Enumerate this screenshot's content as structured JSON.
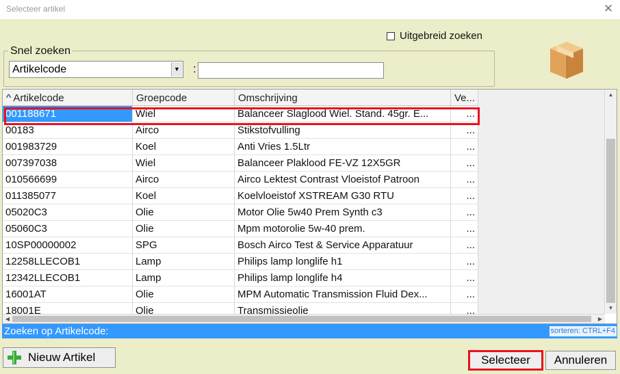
{
  "window": {
    "title": "Selecteer artikel",
    "close_glyph": "✕"
  },
  "options": {
    "uitgebreid_label": "Uitgebreid zoeken",
    "uitgebreid_checked": false
  },
  "quick_search": {
    "legend": "Snel zoeken",
    "field_selected": "Artikelcode",
    "separator": ":",
    "query_value": ""
  },
  "grid": {
    "columns": [
      "^ Artikelcode",
      "Groepcode",
      "Omschrijving",
      "Ve..."
    ],
    "rows": [
      [
        "001188671",
        "Wiel",
        "Balanceer Slaglood Wiel. Stand. 45gr. E...",
        "..."
      ],
      [
        "00183",
        "Airco",
        "Stikstofvulling",
        "..."
      ],
      [
        "001983729",
        "Koel",
        "Anti Vries 1.5Ltr",
        "..."
      ],
      [
        "007397038",
        "Wiel",
        "Balanceer Plaklood FE-VZ 12X5GR",
        "..."
      ],
      [
        "010566699",
        "Airco",
        "Airco Lektest Contrast Vloeistof Patroon",
        "..."
      ],
      [
        "011385077",
        "Koel",
        "Koelvloeistof XSTREAM G30 RTU",
        "..."
      ],
      [
        "05020C3",
        "Olie",
        "Motor Olie 5w40 Prem Synth c3",
        "..."
      ],
      [
        "05060C3",
        "Olie",
        "Mpm motorolie 5w-40 prem.",
        "..."
      ],
      [
        "10SP00000002",
        "SPG",
        "Bosch Airco Test & Service Apparatuur",
        "..."
      ],
      [
        "12258LLECOB1",
        "Lamp",
        "Philips lamp longlife h1",
        "..."
      ],
      [
        "12342LLECOB1",
        "Lamp",
        "Philips lamp longlife h4",
        "..."
      ],
      [
        "16001AT",
        "Olie",
        "MPM Automatic Transmission Fluid Dex...",
        "..."
      ],
      [
        "18001E",
        "Olie",
        "Transmissieolie",
        "..."
      ]
    ],
    "selected_index": 0
  },
  "status": {
    "text": "Zoeken op Artikelcode:",
    "sort_hint": "sorteren: CTRL+F4"
  },
  "buttons": {
    "new_label": "Nieuw Artikel",
    "select_label": "Selecteer",
    "cancel_label": "Annuleren"
  },
  "icons": {
    "box": "package-icon",
    "plus": "plus-icon"
  },
  "colors": {
    "selection": "#3399ff",
    "highlight_frame": "#e8111e",
    "background": "#ecedc9"
  }
}
